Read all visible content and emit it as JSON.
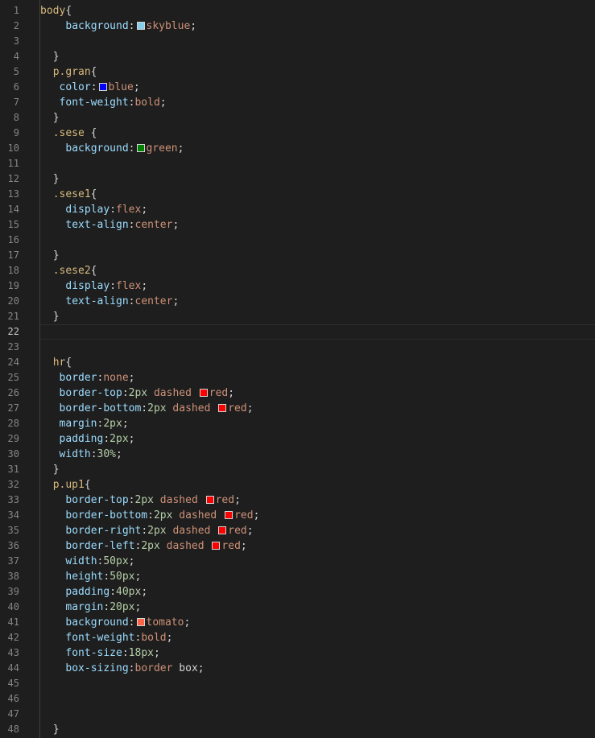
{
  "editor": {
    "lines": [
      {
        "n": "1",
        "indent": 0,
        "parts": [
          {
            "t": "body",
            "c": "tag"
          },
          {
            "t": "{",
            "c": "punc"
          }
        ]
      },
      {
        "n": "2",
        "indent": 4,
        "parts": [
          {
            "t": "background",
            "c": "prop"
          },
          {
            "t": ":",
            "c": "punc"
          },
          {
            "swatch": "#87ceeb"
          },
          {
            "t": "skyblue",
            "c": "val"
          },
          {
            "t": ";",
            "c": "punc"
          }
        ]
      },
      {
        "n": "3",
        "indent": 0,
        "parts": []
      },
      {
        "n": "4",
        "indent": 2,
        "parts": [
          {
            "t": "}",
            "c": "punc"
          }
        ]
      },
      {
        "n": "5",
        "indent": 2,
        "parts": [
          {
            "t": "p.gran",
            "c": "tag"
          },
          {
            "t": "{",
            "c": "punc"
          }
        ]
      },
      {
        "n": "6",
        "indent": 3,
        "parts": [
          {
            "t": "color",
            "c": "prop"
          },
          {
            "t": ":",
            "c": "punc"
          },
          {
            "swatch": "#0000ff"
          },
          {
            "t": "blue",
            "c": "val"
          },
          {
            "t": ";",
            "c": "punc"
          }
        ]
      },
      {
        "n": "7",
        "indent": 3,
        "parts": [
          {
            "t": "font-weight",
            "c": "prop"
          },
          {
            "t": ":",
            "c": "punc"
          },
          {
            "t": "bold",
            "c": "val"
          },
          {
            "t": ";",
            "c": "punc"
          }
        ]
      },
      {
        "n": "8",
        "indent": 2,
        "parts": [
          {
            "t": "}",
            "c": "punc"
          }
        ]
      },
      {
        "n": "9",
        "indent": 2,
        "parts": [
          {
            "t": ".sese",
            "c": "tag"
          },
          {
            "t": " {",
            "c": "punc"
          }
        ]
      },
      {
        "n": "10",
        "indent": 4,
        "parts": [
          {
            "t": "background",
            "c": "prop"
          },
          {
            "t": ":",
            "c": "punc"
          },
          {
            "swatch": "#008000"
          },
          {
            "t": "green",
            "c": "val"
          },
          {
            "t": ";",
            "c": "punc"
          }
        ]
      },
      {
        "n": "11",
        "indent": 0,
        "parts": []
      },
      {
        "n": "12",
        "indent": 2,
        "parts": [
          {
            "t": "}",
            "c": "punc"
          }
        ]
      },
      {
        "n": "13",
        "indent": 2,
        "parts": [
          {
            "t": ".sese1",
            "c": "tag"
          },
          {
            "t": "{",
            "c": "punc"
          }
        ]
      },
      {
        "n": "14",
        "indent": 4,
        "parts": [
          {
            "t": "display",
            "c": "prop"
          },
          {
            "t": ":",
            "c": "punc"
          },
          {
            "t": "flex",
            "c": "val"
          },
          {
            "t": ";",
            "c": "punc"
          }
        ]
      },
      {
        "n": "15",
        "indent": 4,
        "parts": [
          {
            "t": "text-align",
            "c": "prop"
          },
          {
            "t": ":",
            "c": "punc"
          },
          {
            "t": "center",
            "c": "val"
          },
          {
            "t": ";",
            "c": "punc"
          }
        ]
      },
      {
        "n": "16",
        "indent": 0,
        "parts": []
      },
      {
        "n": "17",
        "indent": 2,
        "parts": [
          {
            "t": "}",
            "c": "punc"
          }
        ]
      },
      {
        "n": "18",
        "indent": 2,
        "parts": [
          {
            "t": ".sese2",
            "c": "tag"
          },
          {
            "t": "{",
            "c": "punc"
          }
        ]
      },
      {
        "n": "19",
        "indent": 4,
        "parts": [
          {
            "t": "display",
            "c": "prop"
          },
          {
            "t": ":",
            "c": "punc"
          },
          {
            "t": "flex",
            "c": "val"
          },
          {
            "t": ";",
            "c": "punc"
          }
        ]
      },
      {
        "n": "20",
        "indent": 4,
        "parts": [
          {
            "t": "text-align",
            "c": "prop"
          },
          {
            "t": ":",
            "c": "punc"
          },
          {
            "t": "center",
            "c": "val"
          },
          {
            "t": ";",
            "c": "punc"
          }
        ]
      },
      {
        "n": "21",
        "indent": 2,
        "parts": [
          {
            "t": "}",
            "c": "punc"
          }
        ]
      },
      {
        "n": "22",
        "indent": 0,
        "parts": [],
        "current": true
      },
      {
        "n": "23",
        "indent": 0,
        "parts": []
      },
      {
        "n": "24",
        "indent": 2,
        "parts": [
          {
            "t": "hr",
            "c": "tag"
          },
          {
            "t": "{",
            "c": "punc"
          }
        ]
      },
      {
        "n": "25",
        "indent": 3,
        "parts": [
          {
            "t": "border",
            "c": "prop"
          },
          {
            "t": ":",
            "c": "punc"
          },
          {
            "t": "none",
            "c": "val"
          },
          {
            "t": ";",
            "c": "punc"
          }
        ]
      },
      {
        "n": "26",
        "indent": 3,
        "parts": [
          {
            "t": "border-top",
            "c": "prop"
          },
          {
            "t": ":",
            "c": "punc"
          },
          {
            "t": "2px",
            "c": "num"
          },
          {
            "t": " dashed ",
            "c": "val"
          },
          {
            "swatch": "#ff0000"
          },
          {
            "t": "red",
            "c": "val"
          },
          {
            "t": ";",
            "c": "punc"
          }
        ]
      },
      {
        "n": "27",
        "indent": 3,
        "parts": [
          {
            "t": "border-bottom",
            "c": "prop"
          },
          {
            "t": ":",
            "c": "punc"
          },
          {
            "t": "2px",
            "c": "num"
          },
          {
            "t": " dashed ",
            "c": "val"
          },
          {
            "swatch": "#ff0000"
          },
          {
            "t": "red",
            "c": "val"
          },
          {
            "t": ";",
            "c": "punc"
          }
        ]
      },
      {
        "n": "28",
        "indent": 3,
        "parts": [
          {
            "t": "margin",
            "c": "prop"
          },
          {
            "t": ":",
            "c": "punc"
          },
          {
            "t": "2px",
            "c": "num"
          },
          {
            "t": ";",
            "c": "punc"
          }
        ]
      },
      {
        "n": "29",
        "indent": 3,
        "parts": [
          {
            "t": "padding",
            "c": "prop"
          },
          {
            "t": ":",
            "c": "punc"
          },
          {
            "t": "2px",
            "c": "num"
          },
          {
            "t": ";",
            "c": "punc"
          }
        ]
      },
      {
        "n": "30",
        "indent": 3,
        "parts": [
          {
            "t": "width",
            "c": "prop"
          },
          {
            "t": ":",
            "c": "punc"
          },
          {
            "t": "30%",
            "c": "num"
          },
          {
            "t": ";",
            "c": "punc"
          }
        ]
      },
      {
        "n": "31",
        "indent": 2,
        "parts": [
          {
            "t": "}",
            "c": "punc"
          }
        ]
      },
      {
        "n": "32",
        "indent": 2,
        "parts": [
          {
            "t": "p.up1",
            "c": "tag"
          },
          {
            "t": "{",
            "c": "punc"
          }
        ]
      },
      {
        "n": "33",
        "indent": 4,
        "parts": [
          {
            "t": "border-top",
            "c": "prop"
          },
          {
            "t": ":",
            "c": "punc"
          },
          {
            "t": "2px",
            "c": "num"
          },
          {
            "t": " dashed ",
            "c": "val"
          },
          {
            "swatch": "#ff0000"
          },
          {
            "t": "red",
            "c": "val"
          },
          {
            "t": ";",
            "c": "punc"
          }
        ]
      },
      {
        "n": "34",
        "indent": 4,
        "parts": [
          {
            "t": "border-bottom",
            "c": "prop"
          },
          {
            "t": ":",
            "c": "punc"
          },
          {
            "t": "2px",
            "c": "num"
          },
          {
            "t": " dashed ",
            "c": "val"
          },
          {
            "swatch": "#ff0000"
          },
          {
            "t": "red",
            "c": "val"
          },
          {
            "t": ";",
            "c": "punc"
          }
        ]
      },
      {
        "n": "35",
        "indent": 4,
        "parts": [
          {
            "t": "border-right",
            "c": "prop"
          },
          {
            "t": ":",
            "c": "punc"
          },
          {
            "t": "2px",
            "c": "num"
          },
          {
            "t": " dashed ",
            "c": "val"
          },
          {
            "swatch": "#ff0000"
          },
          {
            "t": "red",
            "c": "val"
          },
          {
            "t": ";",
            "c": "punc"
          }
        ]
      },
      {
        "n": "36",
        "indent": 4,
        "parts": [
          {
            "t": "border-left",
            "c": "prop"
          },
          {
            "t": ":",
            "c": "punc"
          },
          {
            "t": "2px",
            "c": "num"
          },
          {
            "t": " dashed ",
            "c": "val"
          },
          {
            "swatch": "#ff0000"
          },
          {
            "t": "red",
            "c": "val"
          },
          {
            "t": ";",
            "c": "punc"
          }
        ]
      },
      {
        "n": "37",
        "indent": 4,
        "parts": [
          {
            "t": "width",
            "c": "prop"
          },
          {
            "t": ":",
            "c": "punc"
          },
          {
            "t": "50px",
            "c": "num"
          },
          {
            "t": ";",
            "c": "punc"
          }
        ]
      },
      {
        "n": "38",
        "indent": 4,
        "parts": [
          {
            "t": "height",
            "c": "prop"
          },
          {
            "t": ":",
            "c": "punc"
          },
          {
            "t": "50px",
            "c": "num"
          },
          {
            "t": ";",
            "c": "punc"
          }
        ]
      },
      {
        "n": "39",
        "indent": 4,
        "parts": [
          {
            "t": "padding",
            "c": "prop"
          },
          {
            "t": ":",
            "c": "punc"
          },
          {
            "t": "40px",
            "c": "num"
          },
          {
            "t": ";",
            "c": "punc"
          }
        ]
      },
      {
        "n": "40",
        "indent": 4,
        "parts": [
          {
            "t": "margin",
            "c": "prop"
          },
          {
            "t": ":",
            "c": "punc"
          },
          {
            "t": "20px",
            "c": "num"
          },
          {
            "t": ";",
            "c": "punc"
          }
        ]
      },
      {
        "n": "41",
        "indent": 4,
        "parts": [
          {
            "t": "background",
            "c": "prop"
          },
          {
            "t": ":",
            "c": "punc"
          },
          {
            "swatch": "#ff6347"
          },
          {
            "t": "tomato",
            "c": "val"
          },
          {
            "t": ";",
            "c": "punc"
          }
        ]
      },
      {
        "n": "42",
        "indent": 4,
        "parts": [
          {
            "t": "font-weight",
            "c": "prop"
          },
          {
            "t": ":",
            "c": "punc"
          },
          {
            "t": "bold",
            "c": "val"
          },
          {
            "t": ";",
            "c": "punc"
          }
        ]
      },
      {
        "n": "43",
        "indent": 4,
        "parts": [
          {
            "t": "font-size",
            "c": "prop"
          },
          {
            "t": ":",
            "c": "punc"
          },
          {
            "t": "18px",
            "c": "num"
          },
          {
            "t": ";",
            "c": "punc"
          }
        ]
      },
      {
        "n": "44",
        "indent": 4,
        "parts": [
          {
            "t": "box-sizing",
            "c": "prop"
          },
          {
            "t": ":",
            "c": "punc"
          },
          {
            "t": "border",
            "c": "val"
          },
          {
            "t": " box;",
            "c": "punc"
          }
        ]
      },
      {
        "n": "45",
        "indent": 0,
        "parts": []
      },
      {
        "n": "46",
        "indent": 0,
        "parts": []
      },
      {
        "n": "47",
        "indent": 0,
        "parts": []
      },
      {
        "n": "48",
        "indent": 2,
        "parts": [
          {
            "t": "}",
            "c": "punc"
          }
        ]
      }
    ]
  }
}
